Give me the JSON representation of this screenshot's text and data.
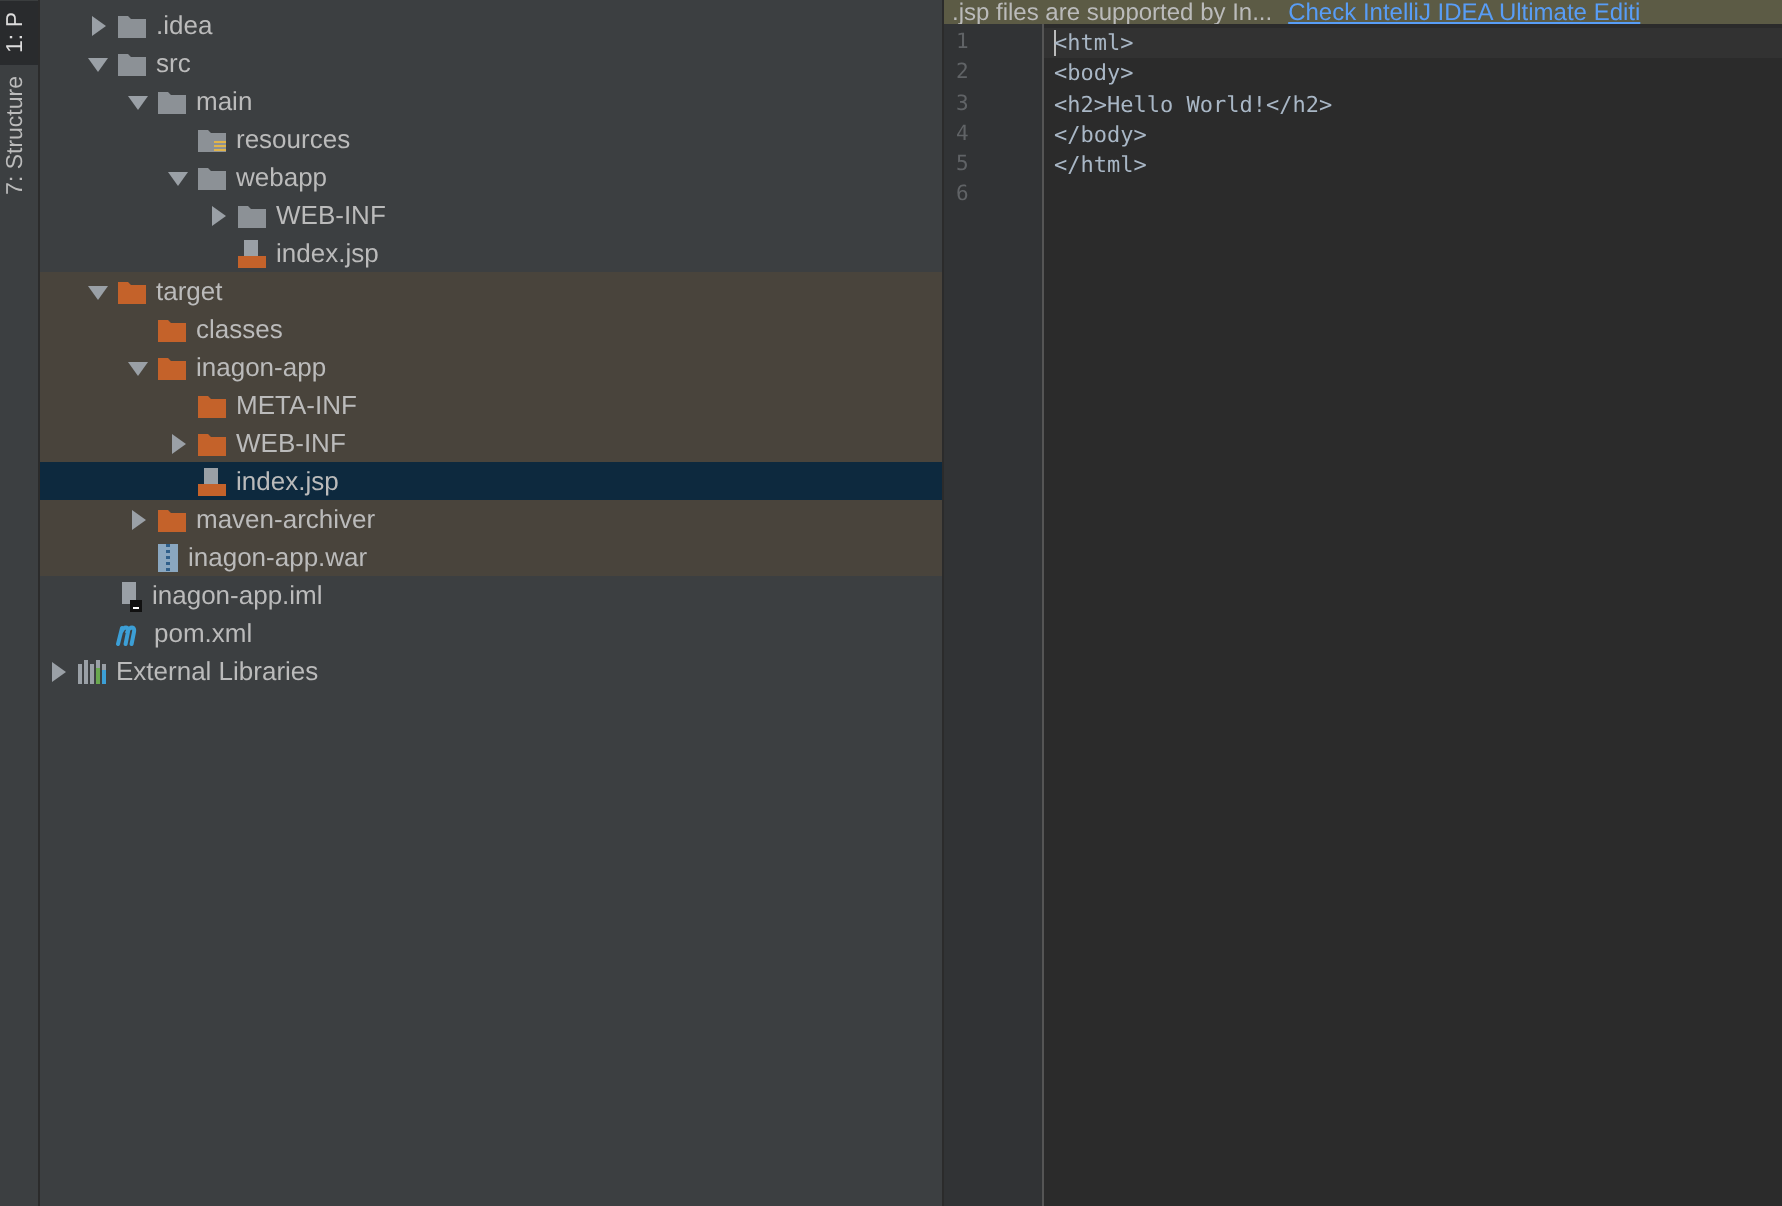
{
  "side_tabs": [
    {
      "label": "1: P",
      "selected": true
    },
    {
      "label": "7: Structure",
      "selected": false
    }
  ],
  "tree": [
    {
      "label": ".idea",
      "kind": "folder",
      "expanded": false,
      "selected": false
    },
    {
      "label": "src",
      "kind": "folder",
      "expanded": true,
      "selected": false,
      "children": [
        {
          "label": "main",
          "kind": "folder",
          "expanded": true,
          "selected": false,
          "children": [
            {
              "label": "resources",
              "kind": "resources",
              "selected": false
            },
            {
              "label": "webapp",
              "kind": "folder",
              "expanded": true,
              "selected": false,
              "children": [
                {
                  "label": "WEB-INF",
                  "kind": "folder",
                  "expanded": false,
                  "selected": false
                },
                {
                  "label": "index.jsp",
                  "kind": "jsp",
                  "selected": false
                }
              ]
            }
          ]
        }
      ]
    },
    {
      "label": "target",
      "kind": "excluded",
      "excluded": true,
      "expanded": true,
      "selected": false,
      "children": [
        {
          "label": "classes",
          "kind": "excluded",
          "selected": false
        },
        {
          "label": "inagon-app",
          "kind": "excluded",
          "expanded": true,
          "selected": false,
          "children": [
            {
              "label": "META-INF",
              "kind": "excluded",
              "selected": false
            },
            {
              "label": "WEB-INF",
              "kind": "excluded",
              "expanded": false,
              "selected": false
            },
            {
              "label": "index.jsp",
              "kind": "jsp",
              "selected": true
            }
          ]
        },
        {
          "label": "maven-archiver",
          "kind": "excluded",
          "expanded": false,
          "selected": false
        },
        {
          "label": "inagon-app.war",
          "kind": "war",
          "selected": false
        }
      ]
    },
    {
      "label": "inagon-app.iml",
      "kind": "iml",
      "selected": false
    },
    {
      "label": "pom.xml",
      "kind": "maven",
      "selected": false
    }
  ],
  "libraries": {
    "label": "External Libraries",
    "expanded": false
  },
  "banner": {
    "text": ".jsp files are supported by In...",
    "link": "Check IntelliJ IDEA Ultimate Editi"
  },
  "editor": {
    "lines": [
      {
        "number": "1",
        "code": "<html>",
        "current": true
      },
      {
        "number": "2",
        "code": "<body>",
        "current": false
      },
      {
        "number": "3",
        "code": "<h2>Hello World!</h2>",
        "current": false
      },
      {
        "number": "4",
        "code": "</body>",
        "current": false
      },
      {
        "number": "5",
        "code": "</html>",
        "current": false
      },
      {
        "number": "6",
        "current": false
      }
    ]
  }
}
